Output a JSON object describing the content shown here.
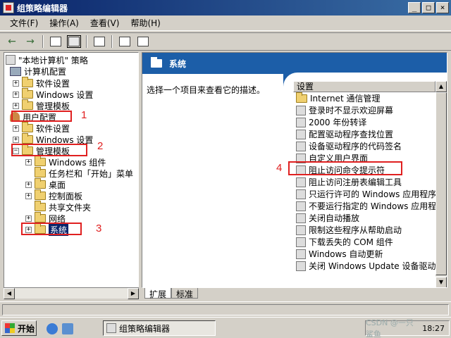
{
  "window": {
    "title": "组策略编辑器",
    "minimize": "_",
    "maximize": "□",
    "close": "×"
  },
  "menu": [
    "文件(F)",
    "操作(A)",
    "查看(V)",
    "帮助(H)"
  ],
  "toolbar": {
    "back": "←",
    "forward": "→"
  },
  "tree": {
    "root": "\"本地计算机\" 策略",
    "computer_config": "计算机配置",
    "cc_software": "软件设置",
    "cc_windows": "Windows 设置",
    "cc_admin": "管理模板",
    "user_config": "用户配置",
    "uc_software": "软件设置",
    "uc_windows": "Windows 设置",
    "uc_admin": "管理模板",
    "win_components": "Windows 组件",
    "taskbar_start": "任务栏和「开始」菜单",
    "desktop": "桌面",
    "control_panel": "控制面板",
    "shared_folders": "共享文件夹",
    "network": "网络",
    "system": "系统"
  },
  "annotations": [
    "1",
    "2",
    "3",
    "4"
  ],
  "right": {
    "header": "系统",
    "description": "选择一个项目来查看它的描述。",
    "column": "设置",
    "items": [
      "Internet 通信管理",
      "登录时不显示欢迎屏幕",
      "2000 年份转译",
      "配置驱动程序查找位置",
      "设备驱动程序的代码签名",
      "自定义用户界面",
      "阻止访问命令提示符",
      "阻止访问注册表编辑工具",
      "只运行许可的 Windows 应用程序",
      "不要运行指定的 Windows 应用程序",
      "关闭自动播放",
      "限制这些程序从帮助启动",
      "下载丢失的 COM 组件",
      "Windows 自动更新",
      "关闭 Windows Update 设备驱动程序"
    ]
  },
  "tabs": [
    "扩展",
    "标准"
  ],
  "taskbar": {
    "start": "开始",
    "task": "组策略编辑器",
    "watermark": "CSDN @一只鲨鱼",
    "clock": "18:27"
  }
}
